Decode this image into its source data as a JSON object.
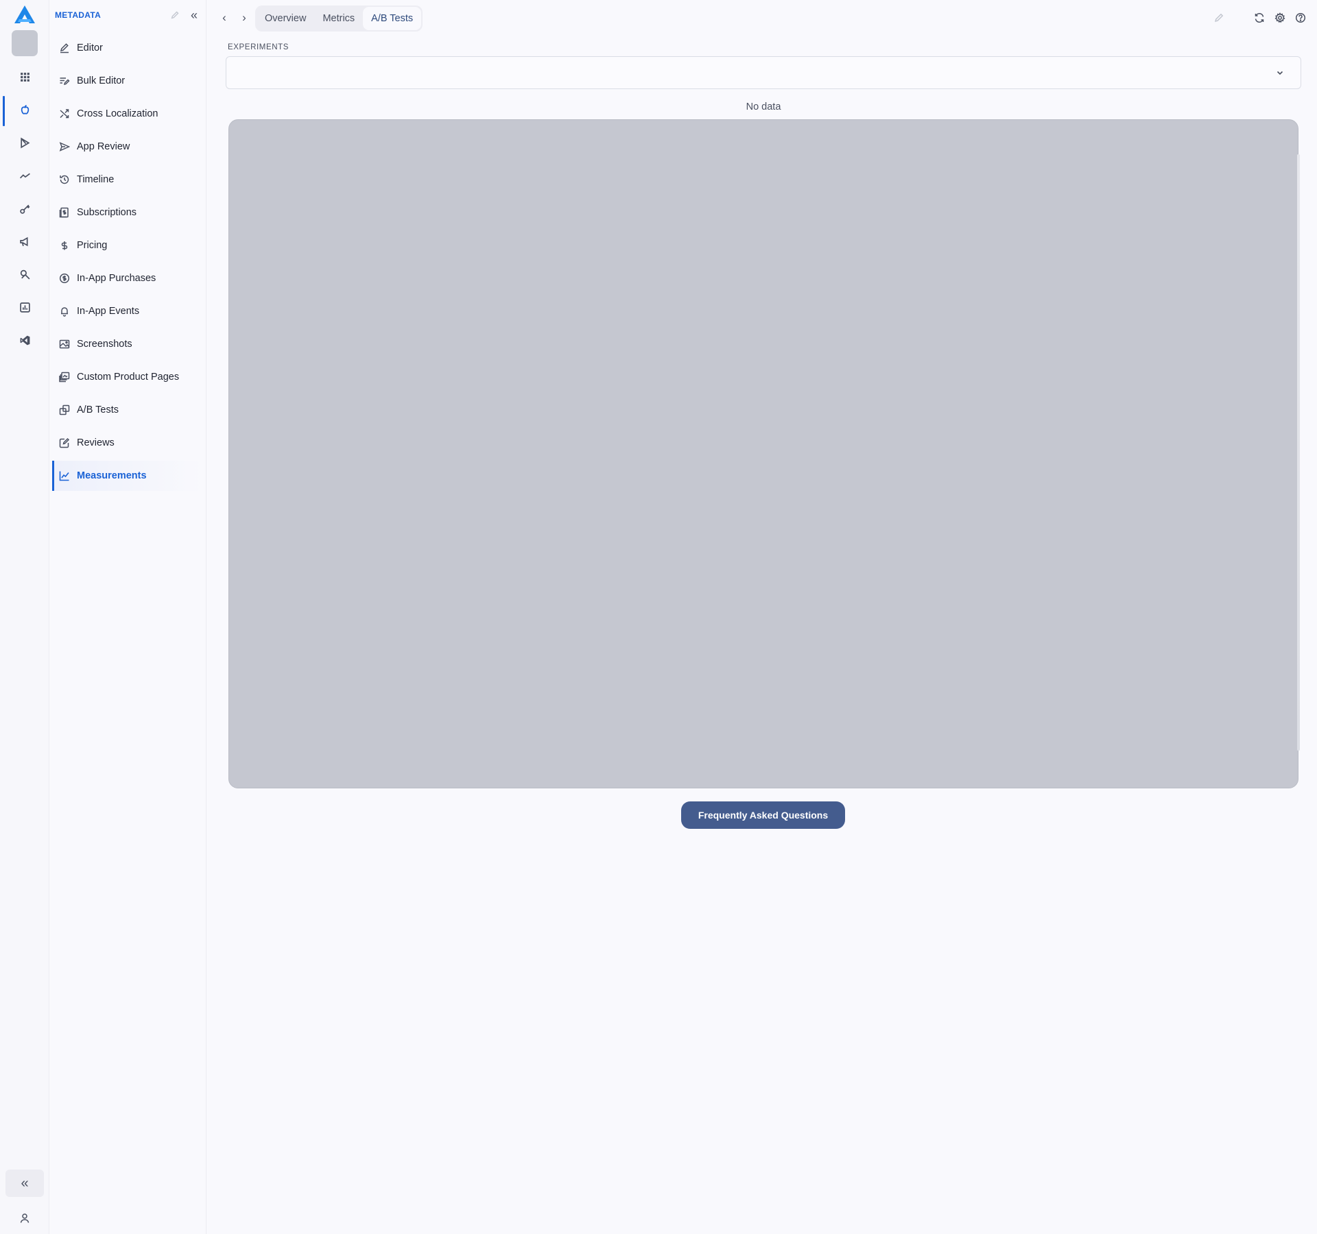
{
  "rail": {
    "items": [
      {
        "id": "apps",
        "icon": "grid-icon"
      },
      {
        "id": "app-store",
        "icon": "apple-icon",
        "active": true
      },
      {
        "id": "google-play",
        "icon": "play-icon"
      },
      {
        "id": "analytics",
        "icon": "trend-icon"
      },
      {
        "id": "keywords",
        "icon": "key-icon"
      },
      {
        "id": "ads",
        "icon": "megaphone-icon"
      },
      {
        "id": "tools",
        "icon": "tools-icon"
      },
      {
        "id": "reports",
        "icon": "report-icon"
      },
      {
        "id": "integrations",
        "icon": "vscode-icon"
      }
    ],
    "collapse_label": "«"
  },
  "subnav": {
    "title": "METADATA",
    "collapse_label": "«",
    "items": [
      {
        "label": "Editor",
        "icon": "pencil-icon"
      },
      {
        "label": "Bulk Editor",
        "icon": "bulk-edit-icon"
      },
      {
        "label": "Cross Localization",
        "icon": "shuffle-icon"
      },
      {
        "label": "App Review",
        "icon": "send-icon"
      },
      {
        "label": "Timeline",
        "icon": "history-icon"
      },
      {
        "label": "Subscriptions",
        "icon": "subscription-icon"
      },
      {
        "label": "Pricing",
        "icon": "dollar-icon"
      },
      {
        "label": "In-App Purchases",
        "icon": "coin-icon"
      },
      {
        "label": "In-App Events",
        "icon": "bell-icon"
      },
      {
        "label": "Screenshots",
        "icon": "image-icon"
      },
      {
        "label": "Custom Product Pages",
        "icon": "pages-icon"
      },
      {
        "label": "A/B Tests",
        "icon": "copy-icon"
      },
      {
        "label": "Reviews",
        "icon": "review-icon"
      },
      {
        "label": "Measurements",
        "icon": "chart-line-icon",
        "active": true
      }
    ]
  },
  "topbar": {
    "back_label": "‹",
    "forward_label": "›",
    "tabs": [
      {
        "label": "Overview"
      },
      {
        "label": "Metrics"
      },
      {
        "label": "A/B Tests",
        "active": true
      }
    ]
  },
  "main": {
    "experiments_label": "EXPERIMENTS",
    "experiments_value": "",
    "no_data": "No data",
    "faq_label": "Frequently Asked Questions"
  },
  "colors": {
    "accent": "#1a62d6",
    "button": "#445c8e",
    "background": "#f9f9fd",
    "placeholder": "#c5c7d0"
  }
}
